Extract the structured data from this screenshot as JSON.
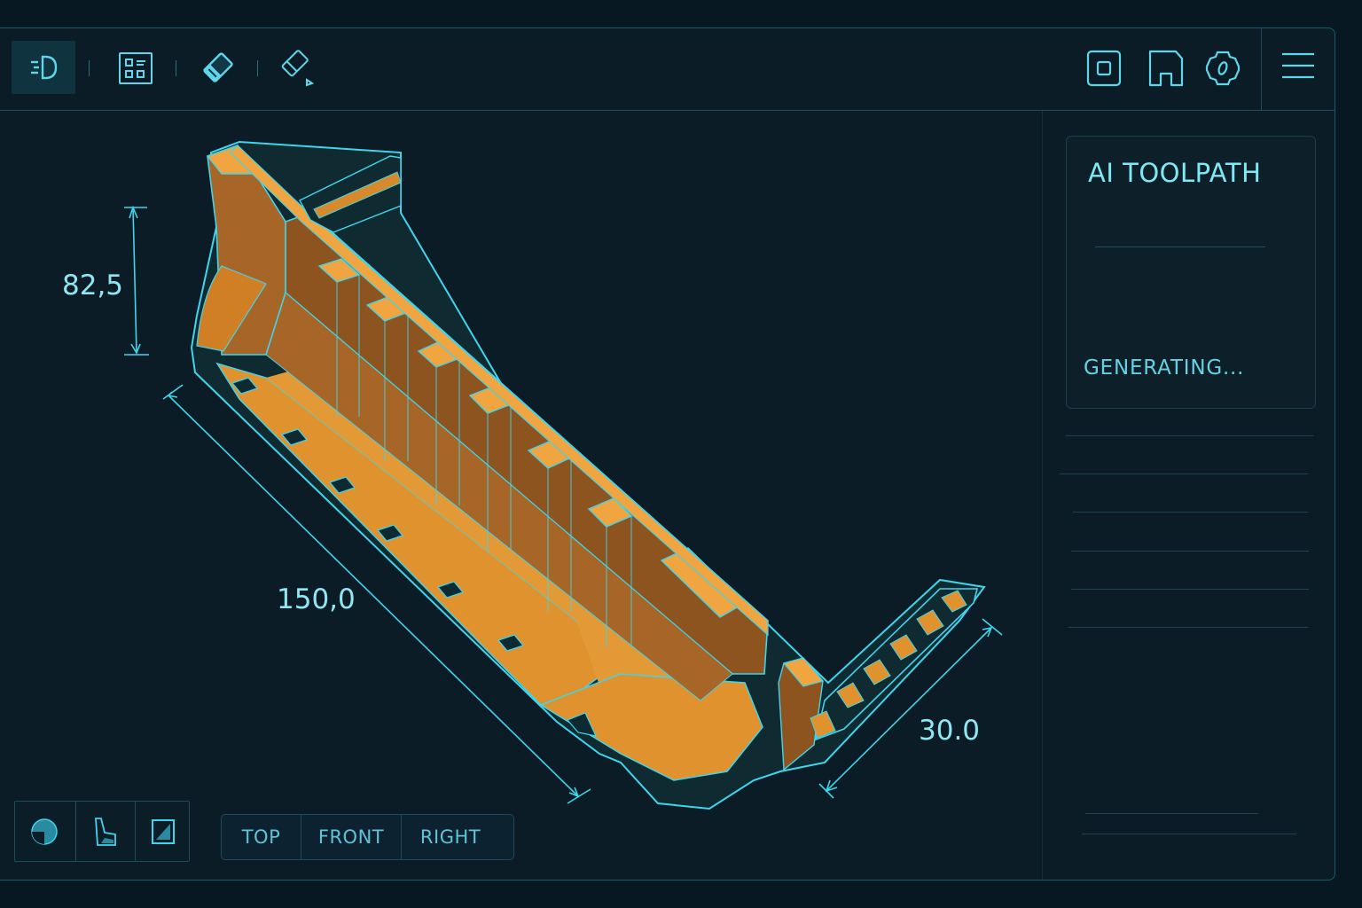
{
  "toolbar": {
    "left_tools": [
      {
        "icon": "view-3d-icon",
        "active": true
      },
      {
        "icon": "grid-panel-icon",
        "active": false
      },
      {
        "icon": "eraser-solid-icon",
        "active": false
      },
      {
        "icon": "eraser-outline-icon",
        "active": false
      }
    ],
    "right_tools": [
      {
        "icon": "stop-square-icon"
      },
      {
        "icon": "save-icon"
      },
      {
        "icon": "settings-gear-icon"
      },
      {
        "icon": "menu-icon"
      }
    ]
  },
  "side_panel": {
    "title": "AI TOOLPATH",
    "status": "GENERATING..."
  },
  "model": {
    "dimensions": {
      "height": "82,5",
      "length": "150,0",
      "width": "30.0"
    },
    "colors": {
      "fill": "#e0922e",
      "edge": "#3fd5ec",
      "wall": "#9a5c22"
    }
  },
  "view_tools": [
    {
      "icon": "shaded-view-icon"
    },
    {
      "icon": "perspective-view-icon"
    },
    {
      "icon": "box-view-icon"
    }
  ],
  "view_tabs": [
    "TOP",
    "FRONT",
    "RIGHT"
  ]
}
